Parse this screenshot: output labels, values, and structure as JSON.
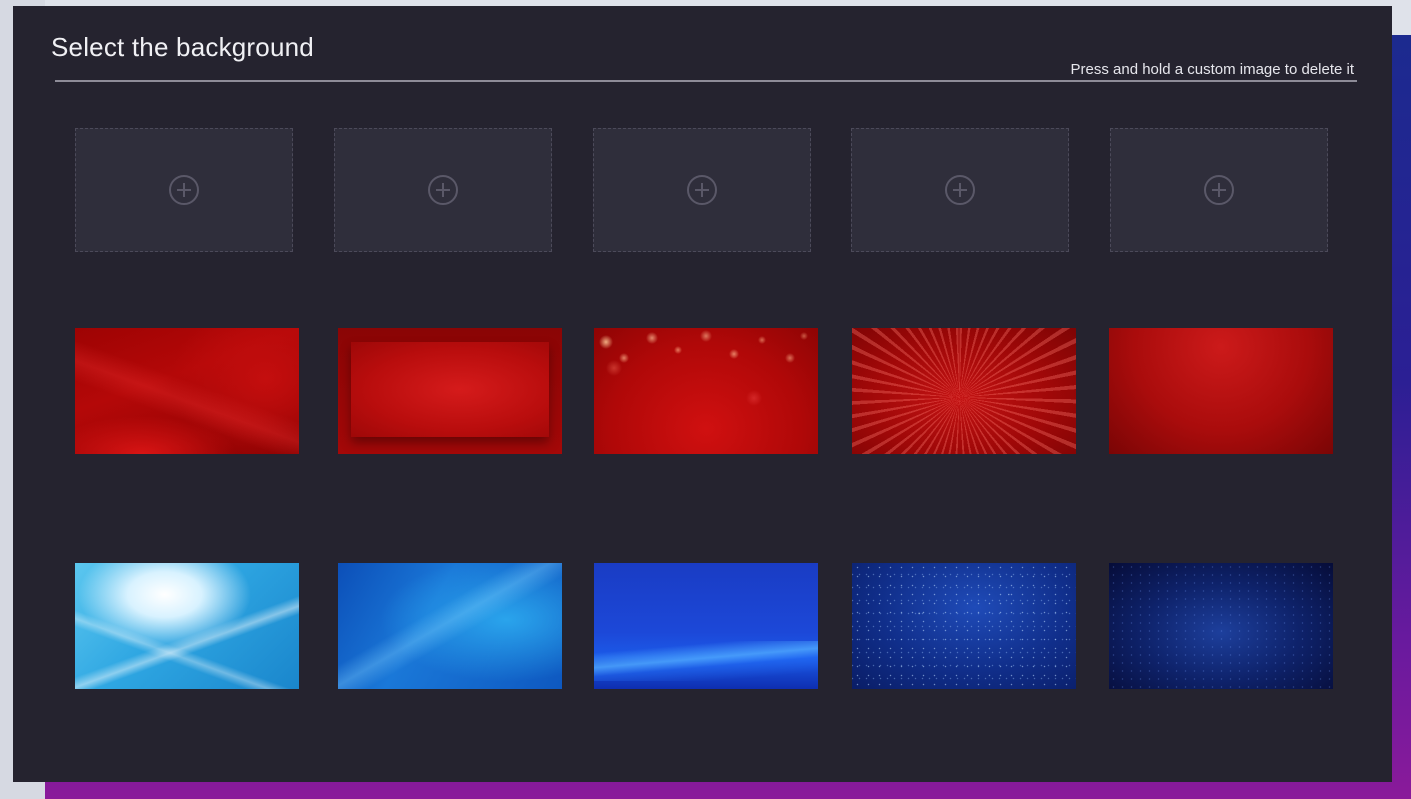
{
  "dialog": {
    "title": "Select the background",
    "hint": "Press and hold a custom image to delete it"
  },
  "custom_slots": [
    {
      "icon": "plus-circle-icon"
    },
    {
      "icon": "plus-circle-icon"
    },
    {
      "icon": "plus-circle-icon"
    },
    {
      "icon": "plus-circle-icon"
    },
    {
      "icon": "plus-circle-icon"
    }
  ],
  "backgrounds": {
    "red": [
      "red-wave",
      "red-framed",
      "red-bokeh",
      "red-burst",
      "red-texture"
    ],
    "blue": [
      "light-blue-wave",
      "blue-wave",
      "deep-blue-streak",
      "blue-sparkle",
      "navy-stardust"
    ]
  },
  "colors": {
    "panel": "#25232f",
    "slot": "#2f2e3b",
    "text": "#f0f0f4",
    "divider": "#8e8c98"
  }
}
